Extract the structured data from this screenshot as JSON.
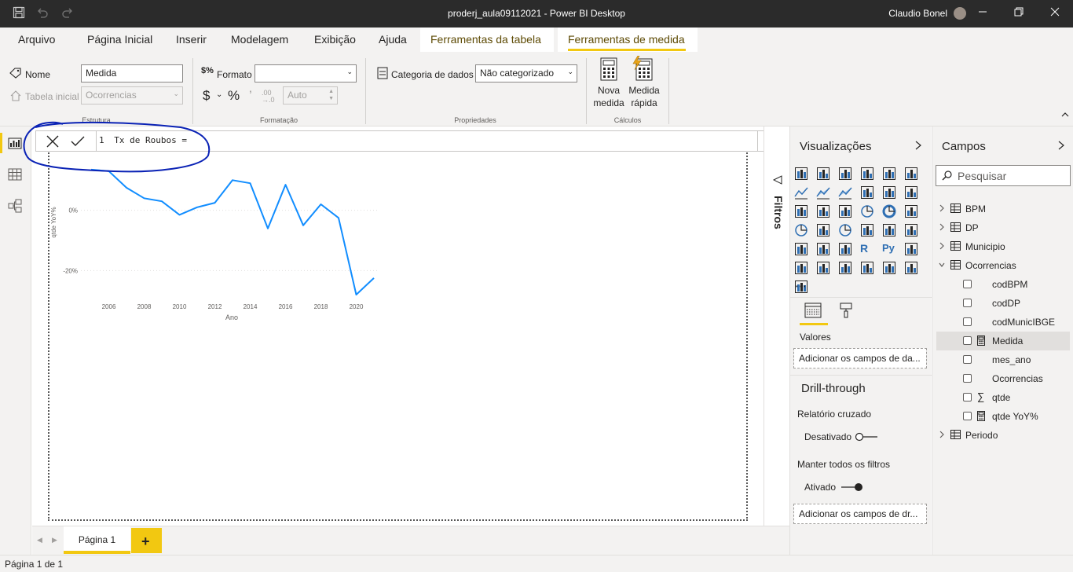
{
  "app": {
    "title": "proderj_aula09112021 - Power BI Desktop",
    "user": "Claudio Bonel"
  },
  "ribbon_tabs": [
    "Arquivo",
    "Página Inicial",
    "Inserir",
    "Modelagem",
    "Exibição",
    "Ajuda",
    "Ferramentas da tabela",
    "Ferramentas de medida"
  ],
  "ribbon": {
    "estrutura": {
      "nome_label": "Nome",
      "nome_value": "Medida",
      "tabela_label": "Tabela inicial",
      "tabela_value": "Ocorrencias",
      "group": "Estrutura"
    },
    "formatacao": {
      "formato_label": "Formato",
      "formato_value": "",
      "dollar": "$",
      "percent": "%",
      "comma": "’",
      "decimals_value": "Auto",
      "group": "Formatação"
    },
    "propriedades": {
      "categoria_label": "Categoria de dados",
      "categoria_value": "Não categorizado",
      "group": "Propriedades"
    },
    "calculos": {
      "nova_line1": "Nova",
      "nova_line2": "medida",
      "rapida_line1": "Medida",
      "rapida_line2": "rápida",
      "group": "Cálculos"
    }
  },
  "formula": {
    "line_number": "1",
    "text": "Tx de Roubos ="
  },
  "chart_data": {
    "type": "line",
    "x": [
      2005,
      2006,
      2007,
      2008,
      2009,
      2010,
      2011,
      2012,
      2013,
      2014,
      2015,
      2016,
      2017,
      2018,
      2019,
      2020,
      2021
    ],
    "values": [
      13.5,
      13.0,
      7.5,
      4.0,
      3.0,
      -1.5,
      1.0,
      2.5,
      10.0,
      9.0,
      -6.0,
      8.5,
      -5.0,
      2.0,
      -2.5,
      -28.0,
      -22.5
    ],
    "ylabel": "qtde YoY%",
    "xlabel": "Ano",
    "x_ticks": [
      "2006",
      "2008",
      "2010",
      "2012",
      "2014",
      "2016",
      "2018",
      "2020"
    ],
    "y_ticks": [
      "0%",
      "-20%"
    ],
    "color": "#118dff"
  },
  "filters_label": "Filtros",
  "viz_pane": {
    "title": "Visualizações",
    "valores_label": "Valores",
    "add_fields": "Adicionar os campos de da...",
    "drill_title": "Drill-through",
    "relatorio_label": "Relatório cruzado",
    "desativado": "Desativado",
    "manter_label": "Manter todos os filtros",
    "ativado": "Ativado",
    "add_drill": "Adicionar os campos de dr...",
    "ellipsis": "⋯"
  },
  "fields_pane": {
    "title": "Campos",
    "search_placeholder": "Pesquisar",
    "tables": [
      "BPM",
      "DP",
      "Municipio",
      "Ocorrencias"
    ],
    "ocorrencias_fields": [
      "codBPM",
      "codDP",
      "codMunicIBGE",
      "Medida",
      "mes_ano",
      "Ocorrencias",
      "qtde",
      "qtde YoY%"
    ],
    "periodo": "Periodo"
  },
  "page_tab": "Página 1",
  "status": "Página 1 de 1",
  "colors": {
    "accent": "#f2c811",
    "line": "#118dff",
    "annotation": "#0a22b5"
  }
}
